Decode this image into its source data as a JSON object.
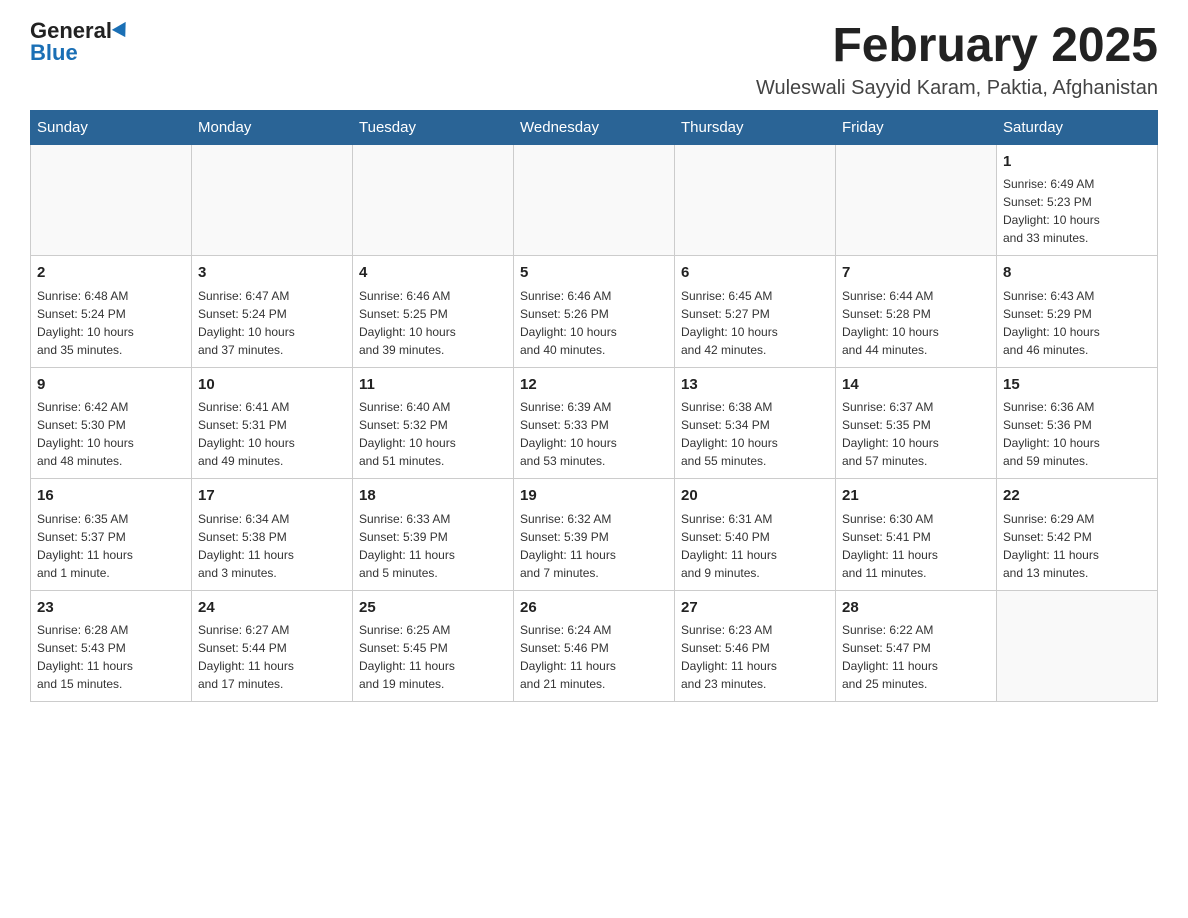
{
  "logo": {
    "general": "General",
    "blue": "Blue"
  },
  "header": {
    "month_year": "February 2025",
    "location": "Wuleswali Sayyid Karam, Paktia, Afghanistan"
  },
  "days_of_week": [
    "Sunday",
    "Monday",
    "Tuesday",
    "Wednesday",
    "Thursday",
    "Friday",
    "Saturday"
  ],
  "weeks": [
    [
      {
        "day": "",
        "info": ""
      },
      {
        "day": "",
        "info": ""
      },
      {
        "day": "",
        "info": ""
      },
      {
        "day": "",
        "info": ""
      },
      {
        "day": "",
        "info": ""
      },
      {
        "day": "",
        "info": ""
      },
      {
        "day": "1",
        "info": "Sunrise: 6:49 AM\nSunset: 5:23 PM\nDaylight: 10 hours\nand 33 minutes."
      }
    ],
    [
      {
        "day": "2",
        "info": "Sunrise: 6:48 AM\nSunset: 5:24 PM\nDaylight: 10 hours\nand 35 minutes."
      },
      {
        "day": "3",
        "info": "Sunrise: 6:47 AM\nSunset: 5:24 PM\nDaylight: 10 hours\nand 37 minutes."
      },
      {
        "day": "4",
        "info": "Sunrise: 6:46 AM\nSunset: 5:25 PM\nDaylight: 10 hours\nand 39 minutes."
      },
      {
        "day": "5",
        "info": "Sunrise: 6:46 AM\nSunset: 5:26 PM\nDaylight: 10 hours\nand 40 minutes."
      },
      {
        "day": "6",
        "info": "Sunrise: 6:45 AM\nSunset: 5:27 PM\nDaylight: 10 hours\nand 42 minutes."
      },
      {
        "day": "7",
        "info": "Sunrise: 6:44 AM\nSunset: 5:28 PM\nDaylight: 10 hours\nand 44 minutes."
      },
      {
        "day": "8",
        "info": "Sunrise: 6:43 AM\nSunset: 5:29 PM\nDaylight: 10 hours\nand 46 minutes."
      }
    ],
    [
      {
        "day": "9",
        "info": "Sunrise: 6:42 AM\nSunset: 5:30 PM\nDaylight: 10 hours\nand 48 minutes."
      },
      {
        "day": "10",
        "info": "Sunrise: 6:41 AM\nSunset: 5:31 PM\nDaylight: 10 hours\nand 49 minutes."
      },
      {
        "day": "11",
        "info": "Sunrise: 6:40 AM\nSunset: 5:32 PM\nDaylight: 10 hours\nand 51 minutes."
      },
      {
        "day": "12",
        "info": "Sunrise: 6:39 AM\nSunset: 5:33 PM\nDaylight: 10 hours\nand 53 minutes."
      },
      {
        "day": "13",
        "info": "Sunrise: 6:38 AM\nSunset: 5:34 PM\nDaylight: 10 hours\nand 55 minutes."
      },
      {
        "day": "14",
        "info": "Sunrise: 6:37 AM\nSunset: 5:35 PM\nDaylight: 10 hours\nand 57 minutes."
      },
      {
        "day": "15",
        "info": "Sunrise: 6:36 AM\nSunset: 5:36 PM\nDaylight: 10 hours\nand 59 minutes."
      }
    ],
    [
      {
        "day": "16",
        "info": "Sunrise: 6:35 AM\nSunset: 5:37 PM\nDaylight: 11 hours\nand 1 minute."
      },
      {
        "day": "17",
        "info": "Sunrise: 6:34 AM\nSunset: 5:38 PM\nDaylight: 11 hours\nand 3 minutes."
      },
      {
        "day": "18",
        "info": "Sunrise: 6:33 AM\nSunset: 5:39 PM\nDaylight: 11 hours\nand 5 minutes."
      },
      {
        "day": "19",
        "info": "Sunrise: 6:32 AM\nSunset: 5:39 PM\nDaylight: 11 hours\nand 7 minutes."
      },
      {
        "day": "20",
        "info": "Sunrise: 6:31 AM\nSunset: 5:40 PM\nDaylight: 11 hours\nand 9 minutes."
      },
      {
        "day": "21",
        "info": "Sunrise: 6:30 AM\nSunset: 5:41 PM\nDaylight: 11 hours\nand 11 minutes."
      },
      {
        "day": "22",
        "info": "Sunrise: 6:29 AM\nSunset: 5:42 PM\nDaylight: 11 hours\nand 13 minutes."
      }
    ],
    [
      {
        "day": "23",
        "info": "Sunrise: 6:28 AM\nSunset: 5:43 PM\nDaylight: 11 hours\nand 15 minutes."
      },
      {
        "day": "24",
        "info": "Sunrise: 6:27 AM\nSunset: 5:44 PM\nDaylight: 11 hours\nand 17 minutes."
      },
      {
        "day": "25",
        "info": "Sunrise: 6:25 AM\nSunset: 5:45 PM\nDaylight: 11 hours\nand 19 minutes."
      },
      {
        "day": "26",
        "info": "Sunrise: 6:24 AM\nSunset: 5:46 PM\nDaylight: 11 hours\nand 21 minutes."
      },
      {
        "day": "27",
        "info": "Sunrise: 6:23 AM\nSunset: 5:46 PM\nDaylight: 11 hours\nand 23 minutes."
      },
      {
        "day": "28",
        "info": "Sunrise: 6:22 AM\nSunset: 5:47 PM\nDaylight: 11 hours\nand 25 minutes."
      },
      {
        "day": "",
        "info": ""
      }
    ]
  ]
}
